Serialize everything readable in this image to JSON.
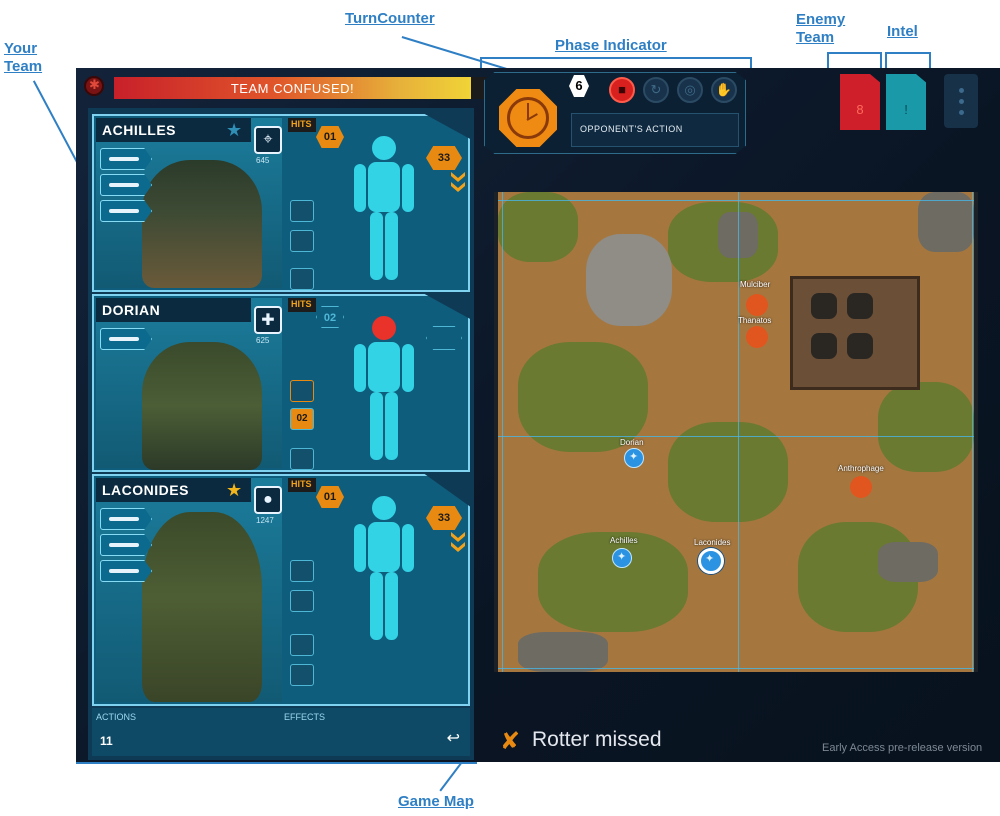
{
  "annotations": {
    "your_team": "Your Team",
    "turn_counter": "TurnCounter",
    "phase_indicator": "Phase Indicator",
    "enemy_team": "Enemy Team",
    "intel": "Intel",
    "game_map": "Game Map"
  },
  "status_banner": "TEAM CONFUSED!",
  "turn": "6",
  "phase": {
    "label": "OPPONENT'S ACTION",
    "buttons": [
      "stop-icon",
      "refresh-icon",
      "target-icon",
      "hand-icon"
    ],
    "active_index": 0
  },
  "team": [
    {
      "name": "ACHILLES",
      "points": "645",
      "role_icon": "crosshair-icon",
      "star": "inactive",
      "hits_label": "HITS",
      "hits": "01",
      "armor": "33",
      "head_hit": false
    },
    {
      "name": "DORIAN",
      "points": "625",
      "role_icon": "medic-cross-icon",
      "star": "none",
      "hits_label": "HITS",
      "hits": "02",
      "armor": "",
      "head_hit": true
    },
    {
      "name": "LACONIDES",
      "points": "1247",
      "role_icon": "grenade-icon",
      "star": "active",
      "hits_label": "HITS",
      "hits": "01",
      "armor": "33",
      "head_hit": false
    }
  ],
  "actions_label": "ACTIONS",
  "actions_value": "11",
  "effects_label": "EFFECTS",
  "enemy_tab": {
    "glyph": "8",
    "color": "#cf1f2a"
  },
  "intel_tab": {
    "glyph": "!",
    "color": "#1a9aa8"
  },
  "map_units": {
    "enemies": [
      "Mulciber",
      "Thanatos",
      "Anthrophage"
    ],
    "friendlies": [
      "Dorian",
      "Achilles",
      "Laconides"
    ]
  },
  "message": "Rotter missed",
  "early_access": "Early Access pre-release version",
  "colors": {
    "accent": "#49b6e6",
    "enemy": "#e0561e",
    "friendly": "#2b93e2",
    "orange": "#e88a12"
  }
}
